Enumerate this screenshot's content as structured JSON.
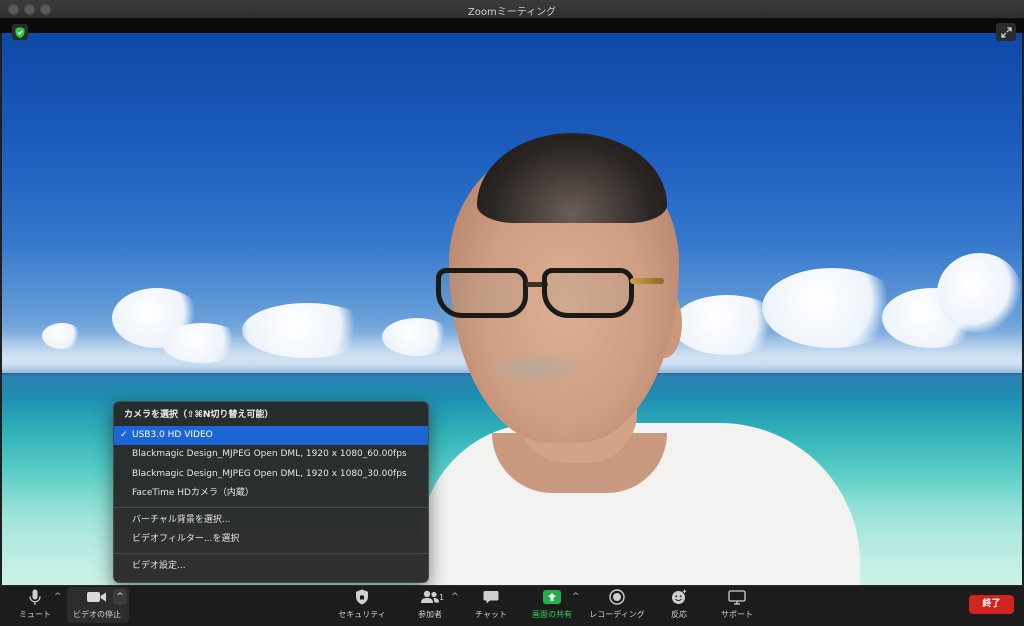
{
  "window": {
    "title": "Zoomミーティング"
  },
  "camera_menu": {
    "header": "カメラを選択（⇧⌘N切り替え可能）",
    "cameras": [
      {
        "label": "USB3.0 HD VIDEO",
        "selected": true
      },
      {
        "label": "Blackmagic Design_MJPEG Open DML, 1920 x 1080_60.00fps",
        "selected": false
      },
      {
        "label": "Blackmagic Design_MJPEG Open DML, 1920 x 1080_30.00fps",
        "selected": false
      },
      {
        "label": "FaceTime HDカメラ（内蔵）",
        "selected": false
      }
    ],
    "virtual_background": "バーチャル背景を選択...",
    "video_filter": "ビデオフィルター...を選択",
    "video_settings": "ビデオ設定...",
    "check_mark": "✓"
  },
  "toolbar": {
    "mute": "ミュート",
    "stop_video": "ビデオの停止",
    "security": "セキュリティ",
    "participants": "参加者",
    "participant_count": "1",
    "chat": "チャット",
    "share_screen": "画面の共有",
    "recording": "レコーディング",
    "reactions": "反応",
    "support": "サポート",
    "end": "終了",
    "caret": "^"
  },
  "colors": {
    "accent_blue": "#1d64d4",
    "share_green": "#22b14c",
    "end_red": "#d0251f"
  }
}
